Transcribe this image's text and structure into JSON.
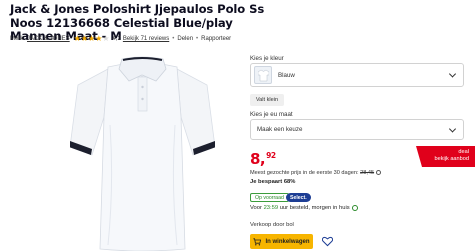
{
  "product": {
    "title": "Jack & Jones Poloshirt Jjepaulos Polo Ss Noos 12136668 Celestial Blue/play Mannen Maat - M",
    "brand_label": "Merk:",
    "brand": "JACK & JONES",
    "rating": "4,2",
    "reviews": "Bekijk 71 reviews",
    "share": "Delen",
    "report": "Rapporteer",
    "image_alt": "polo-shirt"
  },
  "options": {
    "color_label": "Kies je kleur",
    "color_value": "Blauw",
    "size_chart": "Valt klein",
    "size_label": "Kies je eu maat",
    "size_placeholder": "Maak een keuze"
  },
  "pricing": {
    "price_main": "8,",
    "price_cents": "92",
    "deal_line1": "deal",
    "deal_line2": "bekijk aanbod",
    "lowest_text": "Meest gezochte prijs in de eerste 30 dagen:",
    "lowest_price": "28,45",
    "savings": "Je bespaart 68%"
  },
  "availability": {
    "stock_badge": "Op voorraad",
    "select_badge": "Select.",
    "delivery_prefix": "Voor",
    "delivery_time": "23:59",
    "delivery_suffix": "uur besteld, morgen in huis",
    "seller": "Verkoop door bol"
  },
  "actions": {
    "cart_label": "In winkelwagen"
  },
  "colors": {
    "price_red": "#e0001b",
    "cart_yellow": "#f7b500",
    "select_blue": "#1d3d94",
    "stock_green": "#2a8a2a",
    "star": "#f0a800"
  },
  "icons": [
    "star-icon",
    "share-icon",
    "chevron-down-icon",
    "info-icon",
    "check-circle-icon",
    "cart-icon",
    "heart-icon"
  ]
}
